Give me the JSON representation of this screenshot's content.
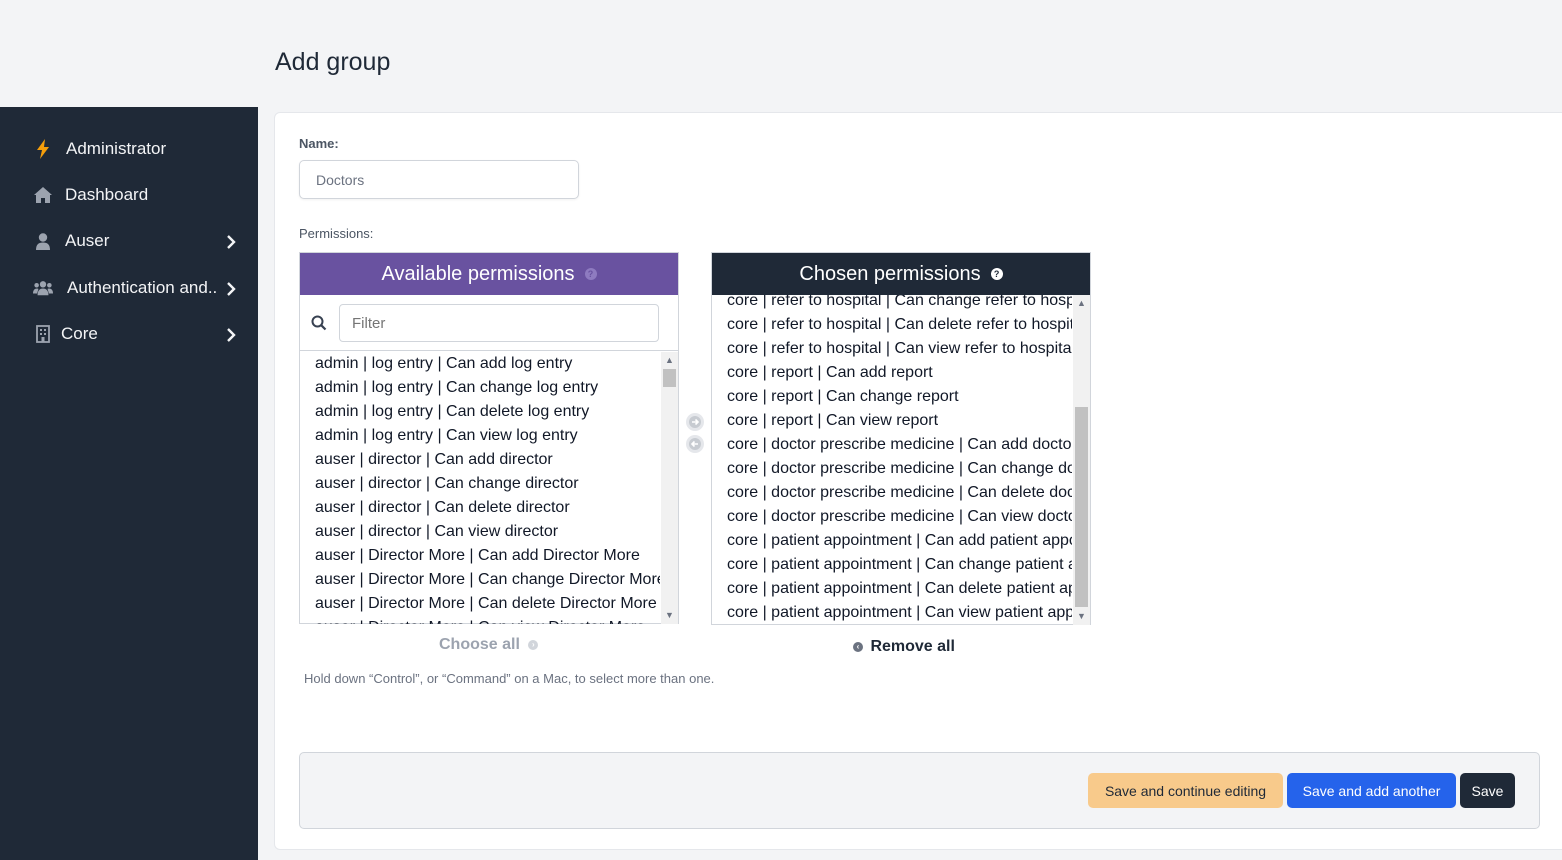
{
  "page": {
    "title": "Add group"
  },
  "sidebar": {
    "items": [
      {
        "label": "Administrator",
        "icon": "bolt-icon"
      },
      {
        "label": "Dashboard",
        "icon": "home-icon"
      },
      {
        "label": "Auser",
        "icon": "user-icon"
      },
      {
        "label": "Authentication and..",
        "icon": "users-icon"
      },
      {
        "label": "Core",
        "icon": "building-icon"
      }
    ]
  },
  "form": {
    "name_label": "Name:",
    "name_value": "Doctors",
    "permissions_label": "Permissions:",
    "help_text": "Hold down “Control”, or “Command” on a Mac, to select more than one."
  },
  "available": {
    "title": "Available permissions",
    "filter_placeholder": "Filter",
    "choose_all_label": "Choose all",
    "options": [
      "admin | log entry | Can add log entry",
      "admin | log entry | Can change log entry",
      "admin | log entry | Can delete log entry",
      "admin | log entry | Can view log entry",
      "auser | director | Can add director",
      "auser | director | Can change director",
      "auser | director | Can delete director",
      "auser | director | Can view director",
      "auser | Director More | Can add Director More",
      "auser | Director More | Can change Director More",
      "auser | Director More | Can delete Director More",
      "auser | Director More | Can view Director More"
    ]
  },
  "chosen": {
    "title": "Chosen permissions",
    "remove_all_label": "Remove all",
    "options": [
      "core | refer to hospital | Can change refer to hospital",
      "core | refer to hospital | Can delete refer to hospital",
      "core | refer to hospital | Can view refer to hospital",
      "core | report | Can add report",
      "core | report | Can change report",
      "core | report | Can view report",
      "core | doctor prescribe medicine | Can add doctor prescribe medicine",
      "core | doctor prescribe medicine | Can change doctor prescribe medicine",
      "core | doctor prescribe medicine | Can delete doctor prescribe medicine",
      "core | doctor prescribe medicine | Can view doctor prescribe medicine",
      "core | patient appointment | Can add patient appointment",
      "core | patient appointment | Can change patient appointment",
      "core | patient appointment | Can delete patient appointment",
      "core | patient appointment | Can view patient appointment"
    ]
  },
  "actions": {
    "save_continue": "Save and continue editing",
    "save_add_another": "Save and add another",
    "save": "Save"
  },
  "colors": {
    "sidebar_bg": "#1f2937",
    "available_header": "#6952a0",
    "chosen_header": "#1f2937",
    "save_continue_bg": "#f8ca8b",
    "save_add_another_bg": "#2563eb",
    "accent_bolt": "#f59e0b"
  }
}
